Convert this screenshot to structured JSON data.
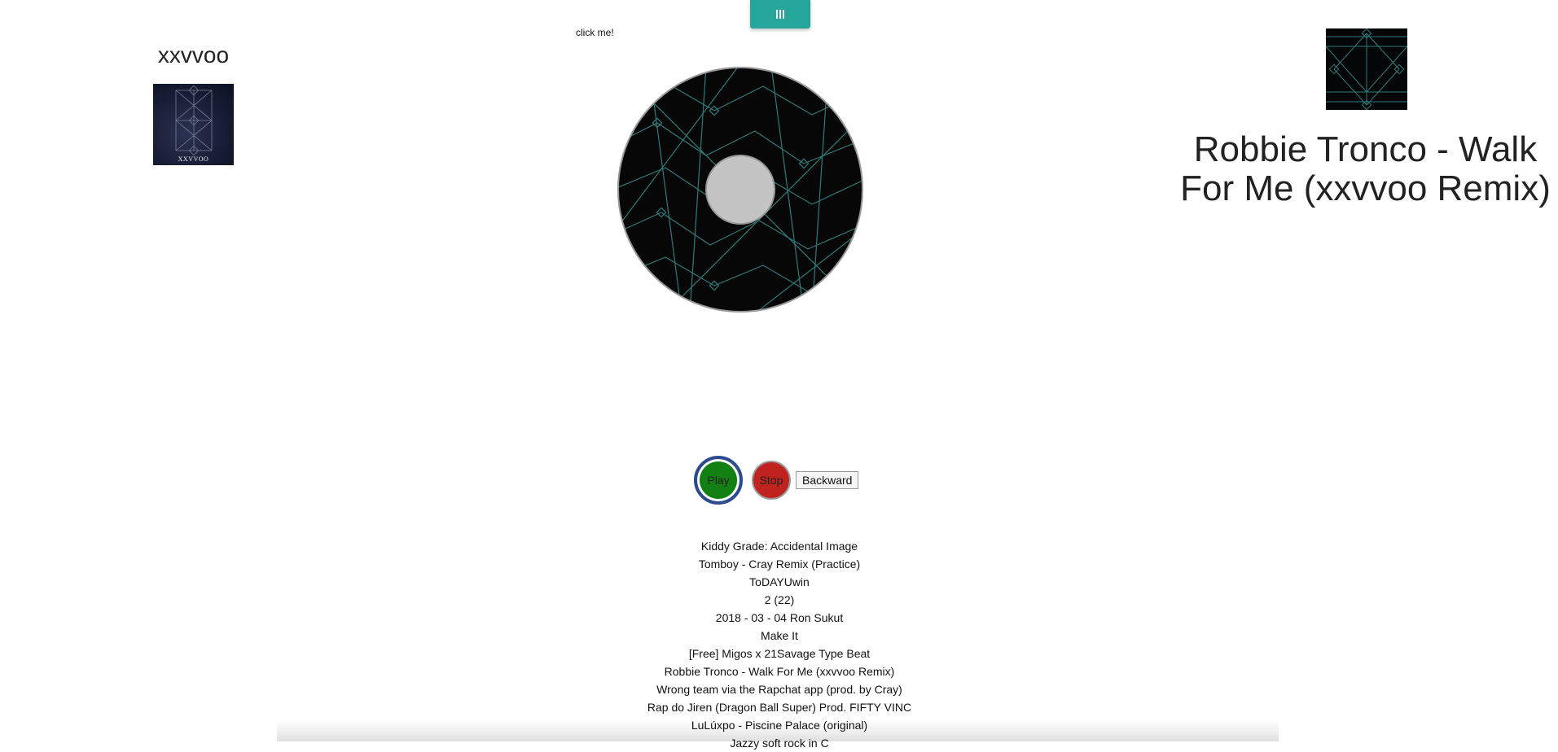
{
  "header": {
    "menu_icon": "bars-icon",
    "click_hint": "click me!",
    "accent_color": "#26a69a"
  },
  "artist": {
    "name": "xxvvoo",
    "art_caption": "XXVVOO"
  },
  "now_playing": {
    "title": "Robbie Tronco - Walk For Me (xxvvoo Remix)"
  },
  "controls": {
    "play_label": "Play",
    "stop_label": "Stop",
    "backward_label": "Backward",
    "play_color": "#128012",
    "stop_color": "#c0221f"
  },
  "playlist": {
    "tracks": [
      "Kiddy Grade: Accidental Image",
      "Tomboy - Cray Remix (Practice)",
      "ToDAYUwin",
      "2 (22)",
      "2018 - 03 - 04 Ron Sukut",
      "Make It",
      "[Free] Migos x 21Savage Type Beat",
      "Robbie Tronco - Walk For Me (xxvvoo Remix)",
      "Wrong team via the Rapchat app (prod. by Cray)",
      "Rap do Jiren (Dragon Ball Super) Prod. FIFTY VINC",
      "LuLúxpo - Piscine Palace (original)",
      "Jazzy soft rock in C"
    ]
  }
}
